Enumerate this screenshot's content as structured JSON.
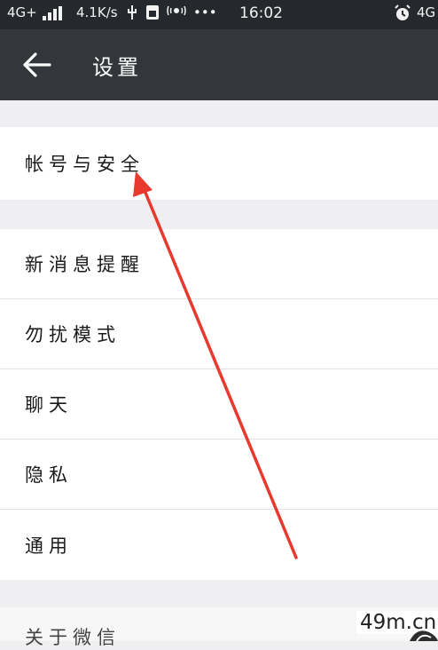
{
  "status_bar": {
    "network": "4G+",
    "speed": "4.1K/s",
    "time": "16:02",
    "right_network": "4G"
  },
  "header": {
    "title": "设置"
  },
  "settings": {
    "group1": [
      {
        "label": "帐号与安全"
      }
    ],
    "group2": [
      {
        "label": "新消息提醒"
      },
      {
        "label": "勿扰模式"
      },
      {
        "label": "聊天"
      },
      {
        "label": "隐私"
      },
      {
        "label": "通用"
      }
    ],
    "group3_partial": "关于微信"
  },
  "watermark": "49m.cn",
  "colors": {
    "status_bar": "#25282c",
    "header": "#33373b",
    "page_background": "#efeff2",
    "row_background": "#ffffff",
    "arrow": "#e8392f"
  },
  "icons": {
    "back": "arrow-left-icon",
    "usb": "usb-icon",
    "sim": "sim-icon",
    "wifi_call": "wifi-calling-icon",
    "alarm": "alarm-clock-icon"
  }
}
